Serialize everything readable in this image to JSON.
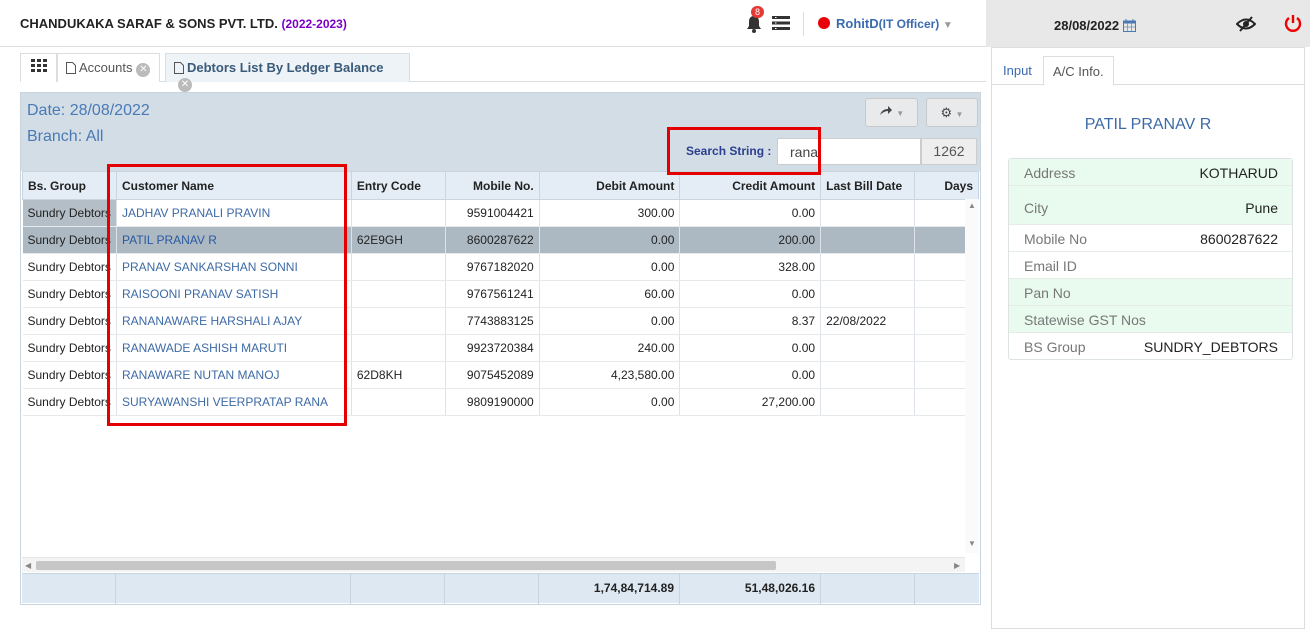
{
  "header": {
    "company": "CHANDUKAKA SARAF & SONS PVT. LTD.",
    "fy": "(2022-2023)",
    "notif_count": "8",
    "user": "RohitD",
    "role": "(IT Officer)",
    "date": "28/08/2022"
  },
  "tabs": [
    {
      "label": "Accounts"
    },
    {
      "label": "Debtors List By Ledger Balance"
    }
  ],
  "panel": {
    "date_text": "Date: 28/08/2022",
    "branch_text": "Branch: All",
    "search_label": "Search String :",
    "search_value": "rana",
    "count": "1262"
  },
  "grid": {
    "columns": [
      "Bs. Group",
      "Customer Name",
      "Entry Code",
      "Mobile No.",
      "Debit Amount",
      "Credit Amount",
      "Last Bill Date",
      "Days"
    ],
    "rows": [
      {
        "group": "Sundry Debtors",
        "name": "JADHAV PRANALI PRAVIN",
        "code": "",
        "mobile": "9591004421",
        "debit": "300.00",
        "credit": "0.00",
        "last": "",
        "days": ""
      },
      {
        "group": "Sundry Debtors",
        "name": "PATIL PRANAV R",
        "code": "62E9GH",
        "mobile": "8600287622",
        "debit": "0.00",
        "credit": "200.00",
        "last": "",
        "days": ""
      },
      {
        "group": "Sundry Debtors",
        "name": "PRANAV SANKARSHAN SONNI",
        "code": "",
        "mobile": "9767182020",
        "debit": "0.00",
        "credit": "328.00",
        "last": "",
        "days": ""
      },
      {
        "group": "Sundry Debtors",
        "name": "RAISOONI PRANAV SATISH",
        "code": "",
        "mobile": "9767561241",
        "debit": "60.00",
        "credit": "0.00",
        "last": "",
        "days": ""
      },
      {
        "group": "Sundry Debtors",
        "name": "RANANAWARE HARSHALI AJAY",
        "code": "",
        "mobile": "7743883125",
        "debit": "0.00",
        "credit": "8.37",
        "last": "22/08/2022",
        "days": ""
      },
      {
        "group": "Sundry Debtors",
        "name": "RANAWADE ASHISH MARUTI",
        "code": "",
        "mobile": "9923720384",
        "debit": "240.00",
        "credit": "0.00",
        "last": "",
        "days": ""
      },
      {
        "group": "Sundry Debtors",
        "name": "RANAWARE NUTAN MANOJ",
        "code": "62D8KH",
        "mobile": "9075452089",
        "debit": "4,23,580.00",
        "credit": "0.00",
        "last": "",
        "days": ""
      },
      {
        "group": "Sundry Debtors",
        "name": "SURYAWANSHI VEERPRATAP RANA",
        "code": "",
        "mobile": "9809190000",
        "debit": "0.00",
        "credit": "27,200.00",
        "last": "",
        "days": ""
      }
    ],
    "totals": {
      "debit": "1,74,84,714.89",
      "credit": "51,48,026.16"
    }
  },
  "right": {
    "tabs": [
      "Input",
      "A/C Info."
    ],
    "customer": "PATIL PRANAV R",
    "info": [
      {
        "label": "Address",
        "value": "KOTHARUD"
      },
      {
        "label": "City",
        "value": "Pune"
      },
      {
        "label": "Mobile No",
        "value": "8600287622"
      },
      {
        "label": "Email ID",
        "value": ""
      },
      {
        "label": "Pan No",
        "value": ""
      },
      {
        "label": "Statewise GST Nos",
        "value": ""
      },
      {
        "label": "BS Group",
        "value": "SUNDRY_DEBTORS"
      }
    ]
  }
}
